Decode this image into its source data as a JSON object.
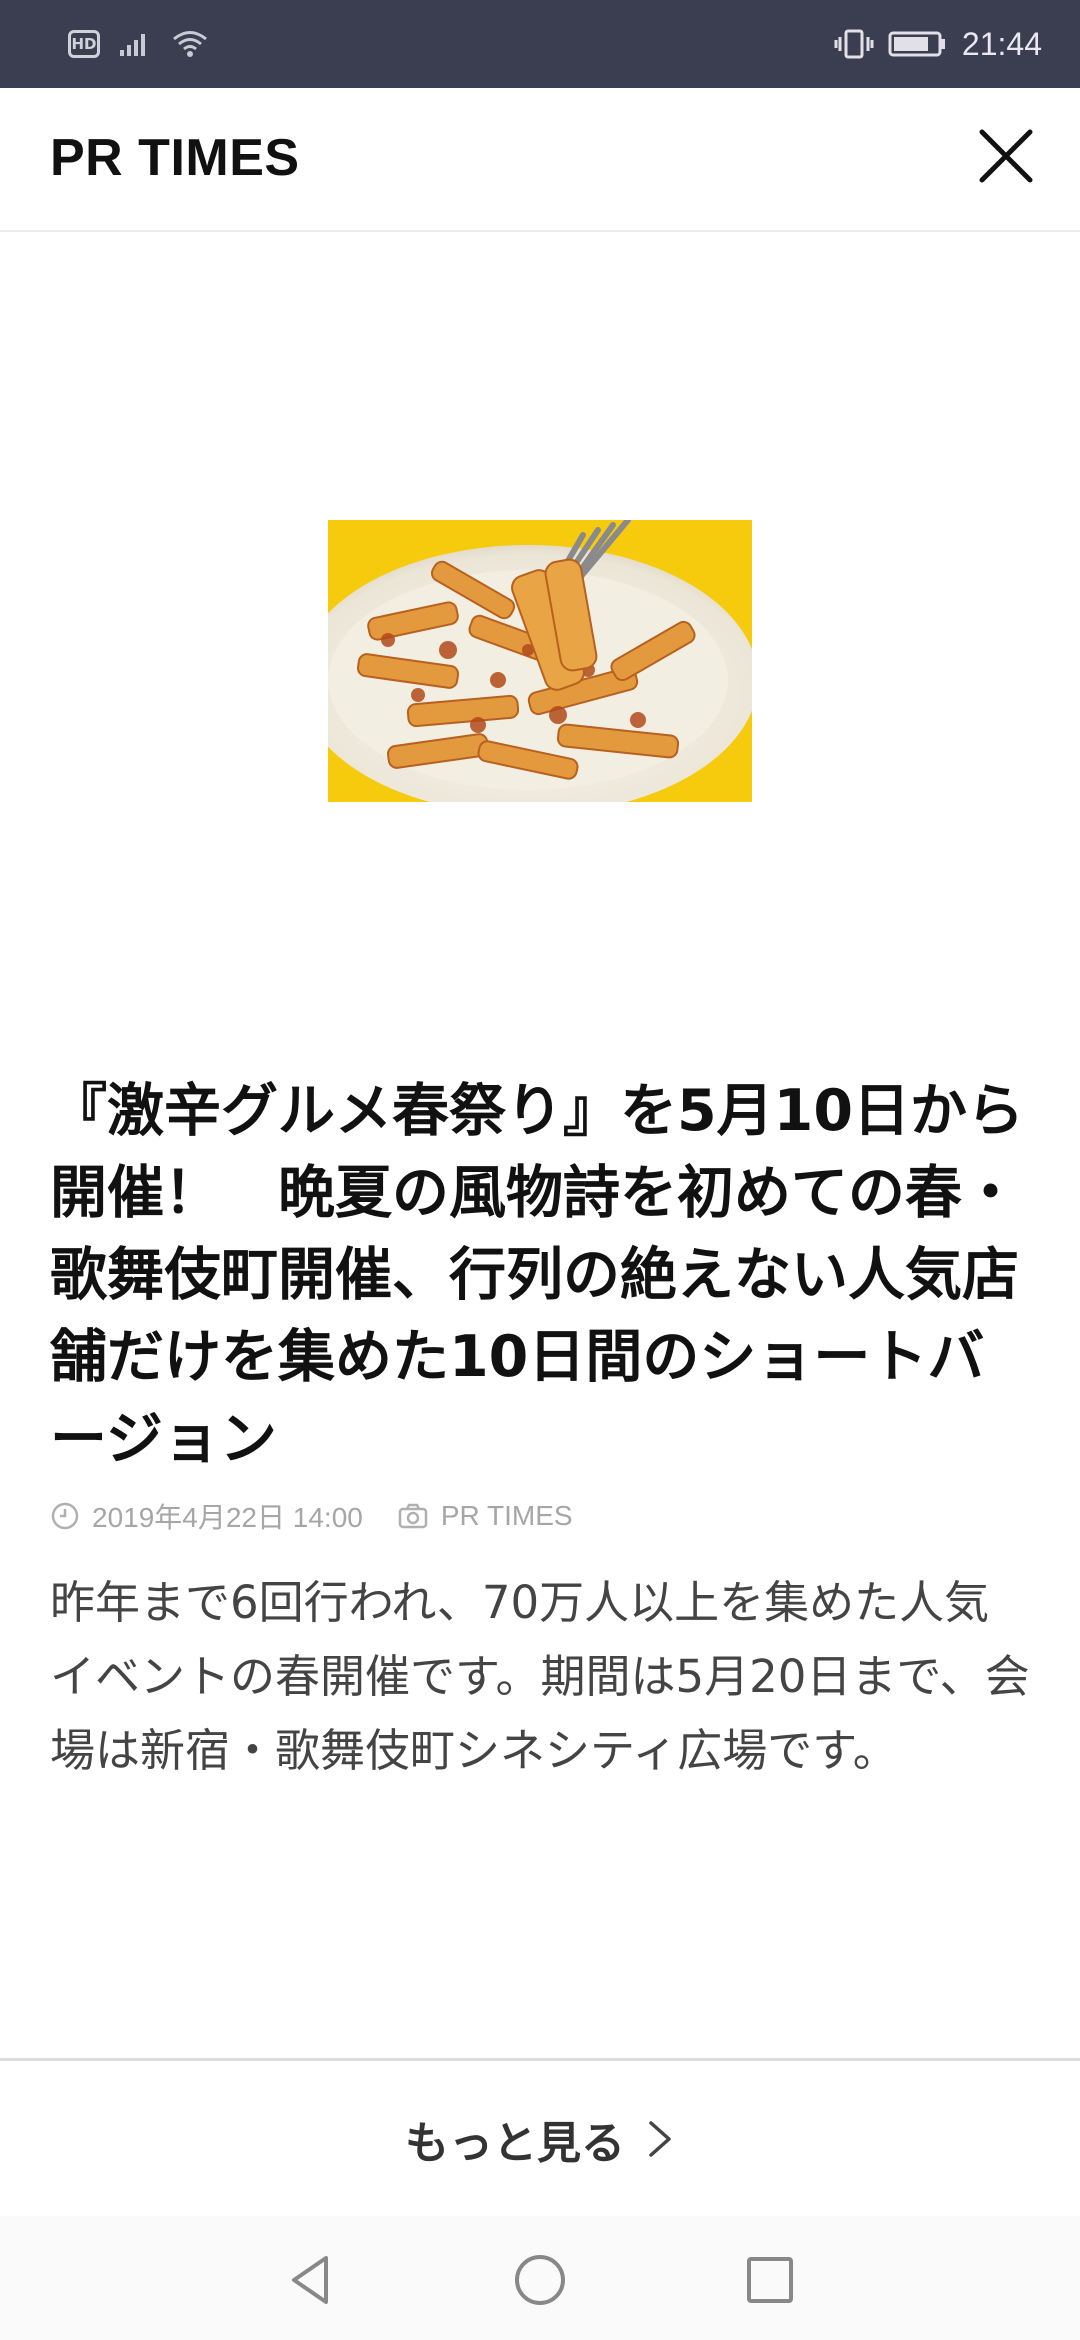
{
  "status_bar": {
    "hd_label": "HD",
    "time": "21:44"
  },
  "header": {
    "title": "PR TIMES"
  },
  "article": {
    "headline": "『激辛グルメ春祭り』を5月10日から開催！　晩夏の風物詩を初めての春・歌舞伎町開催、行列の絶えない人気店舗だけを集めた10日間のショートバージョン",
    "date": "2019年4月22日 14:00",
    "source": "PR TIMES",
    "summary": "昨年まで6回行われ、70万人以上を集めた人気イベントの春開催です。期間は5月20日まで、会場は新宿・歌舞伎町シネシティ広場です。"
  },
  "footer": {
    "more_label": "もっと見る"
  },
  "icons": {
    "clock": "clock-icon",
    "camera": "camera-icon",
    "close": "close-icon",
    "chevron": "chevron-right-icon"
  },
  "colors": {
    "status_bar_bg": "#3b3e50",
    "meta_text": "#a6a6a6",
    "summary_text": "#444444"
  }
}
